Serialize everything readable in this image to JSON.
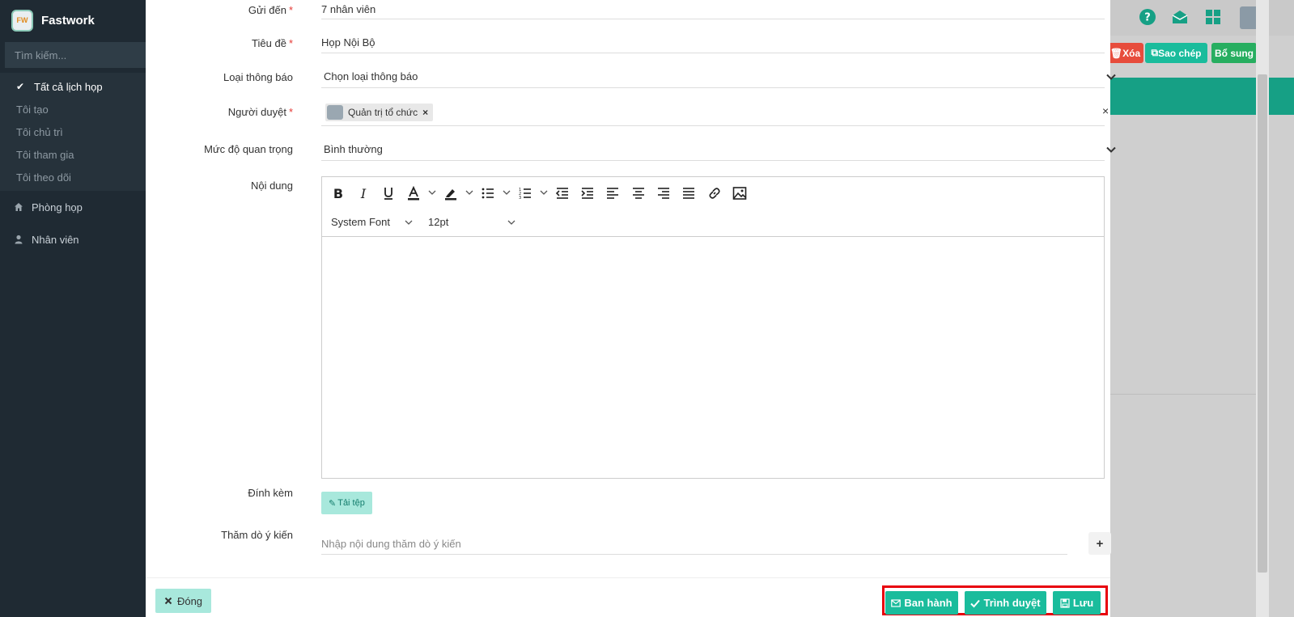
{
  "app": {
    "name": "Fastwork",
    "logo_text": "FW"
  },
  "sidebar": {
    "search_placeholder": "Tìm kiếm...",
    "sub_items": [
      {
        "label": "Tất cả lịch họp",
        "active": true
      },
      {
        "label": "Tôi tạo"
      },
      {
        "label": "Tôi chủ trì"
      },
      {
        "label": "Tôi tham gia"
      },
      {
        "label": "Tôi theo dõi"
      }
    ],
    "nav": [
      {
        "label": "Phòng họp",
        "icon": "home-icon"
      },
      {
        "label": "Nhân viên",
        "icon": "user-icon"
      }
    ]
  },
  "background_page": {
    "buttons": {
      "delete": "Xóa",
      "copy": "Sao chép",
      "add": "Bổ sung"
    },
    "colors": {
      "delete": "#e74c3c",
      "copy": "#1abc9c",
      "add": "#27ae60",
      "band": "#16a085"
    }
  },
  "form": {
    "send_to": {
      "label": "Gửi đến",
      "value": "7 nhân viên"
    },
    "title": {
      "label": "Tiêu đề",
      "value": "Họp Nội Bộ"
    },
    "notice_type": {
      "label": "Loại thông báo",
      "value": "Chọn loại thông báo"
    },
    "approver": {
      "label": "Người duyệt",
      "chip": "Quản trị tổ chức",
      "chip_remove": "×",
      "clear": "×"
    },
    "priority": {
      "label": "Mức độ quan trọng",
      "value": "Bình thường"
    },
    "content": {
      "label": "Nội dung",
      "font": "System Font",
      "size": "12pt"
    },
    "attachment": {
      "label": "Đính kèm",
      "button": "Tải tệp"
    },
    "poll": {
      "label": "Thăm dò ý kiến",
      "placeholder": "Nhập nội dung thăm dò ý kiến",
      "add": "+"
    },
    "required_mark": "*"
  },
  "footer": {
    "close": "Đóng",
    "publish": "Ban hành",
    "submit": "Trình duyệt",
    "save": "Lưu"
  },
  "colors": {
    "accent": "#1abc9c",
    "accent_light": "#a8e8dc",
    "highlight_border": "#e8000b",
    "sidebar_bg": "#1f2a33"
  }
}
